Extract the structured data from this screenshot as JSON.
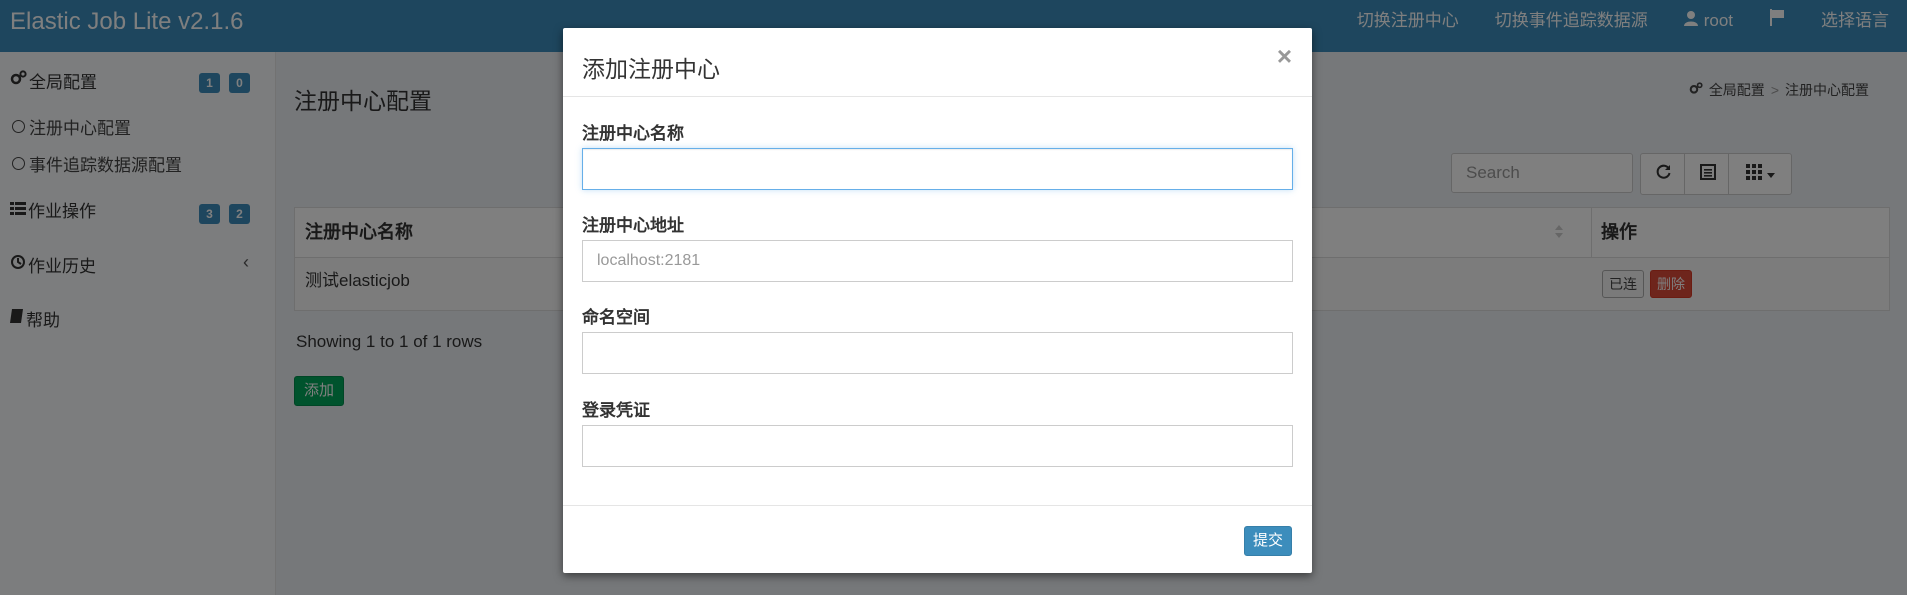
{
  "header": {
    "logo": "Elastic Job Lite v2.1.6",
    "nav": [
      {
        "label": "切换注册中心"
      },
      {
        "label": "切换事件追踪数据源"
      },
      {
        "label": "root"
      },
      {
        "label": ""
      },
      {
        "label": "选择语言"
      }
    ]
  },
  "sidebar": {
    "global_config": {
      "label": "全局配置",
      "badges": [
        "1",
        "0"
      ]
    },
    "reg_center": {
      "label": "注册中心配置"
    },
    "event_trace": {
      "label": "事件追踪数据源配置"
    },
    "job_ops": {
      "label": "作业操作",
      "badges": [
        "3",
        "2"
      ]
    },
    "job_history": {
      "label": "作业历史"
    },
    "help": {
      "label": "帮助"
    }
  },
  "main": {
    "title": "注册中心配置",
    "breadcrumb": [
      "全局配置",
      "注册中心配置"
    ],
    "search": {
      "placeholder": "Search"
    },
    "table": {
      "headers": [
        "注册中心名称",
        "操作"
      ],
      "rows": [
        {
          "name": "测试elasticjob",
          "actions": [
            "已连",
            "删除"
          ]
        }
      ]
    },
    "showing": "Showing 1 to 1 of 1 rows",
    "add_label": "添加"
  },
  "modal": {
    "title": "添加注册中心",
    "close": "×",
    "fields": [
      {
        "label": "注册中心名称",
        "value": "",
        "placeholder": ""
      },
      {
        "label": "注册中心地址",
        "value": "",
        "placeholder": "localhost:2181"
      },
      {
        "label": "命名空间",
        "value": "",
        "placeholder": ""
      },
      {
        "label": "登录凭证",
        "value": "",
        "placeholder": ""
      }
    ],
    "submit_label": "提交"
  },
  "colors": {
    "primary": "#3c8dbc",
    "success": "#00a65a",
    "danger": "#dd4b39",
    "background": "#ecf0f5"
  },
  "icons": {
    "global_config": "gears-icon",
    "reg_center": "circle-icon",
    "event_trace": "circle-icon",
    "job_ops": "tasks-icon",
    "job_history": "history-icon",
    "help": "book-icon",
    "user": "user-icon",
    "flag": "flag-icon",
    "refresh": "refresh-icon",
    "list": "list-icon",
    "columns": "grid-icon"
  }
}
